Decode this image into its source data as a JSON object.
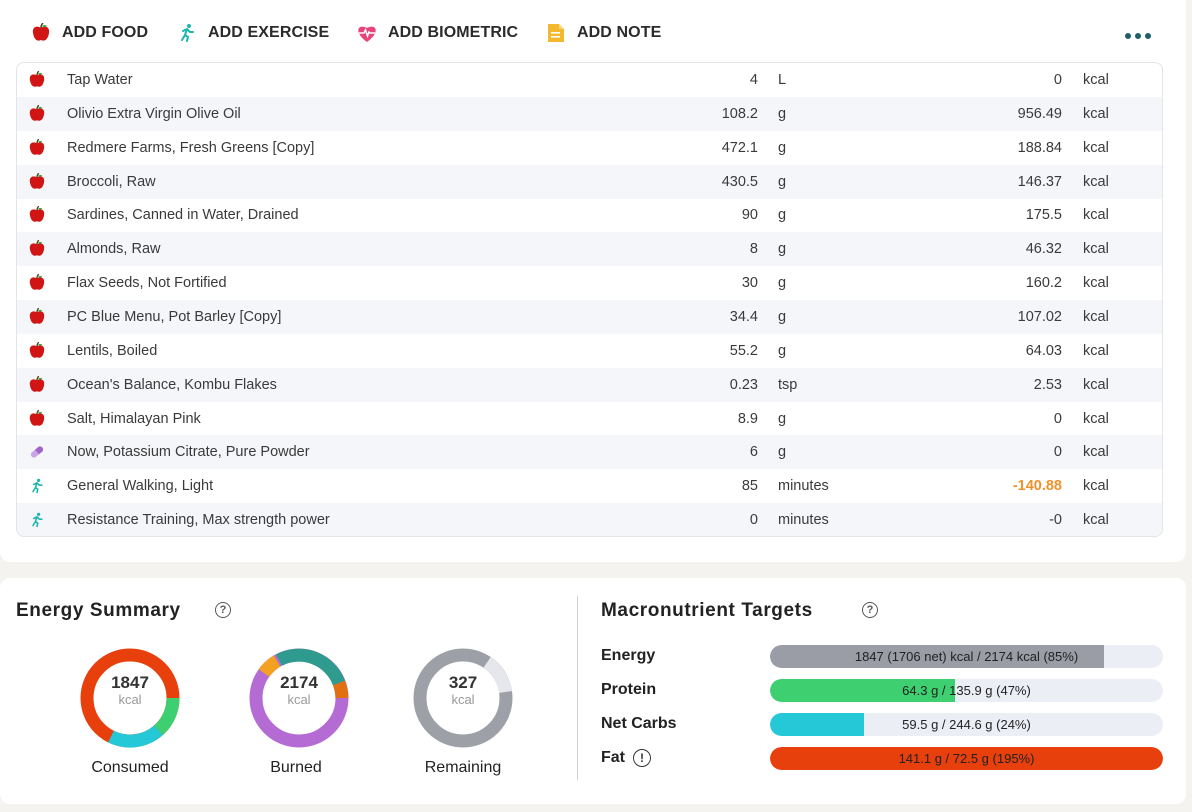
{
  "toolbar": {
    "add_food": "ADD FOOD",
    "add_exercise": "ADD EXERCISE",
    "add_biometric": "ADD BIOMETRIC",
    "add_note": "ADD NOTE"
  },
  "colors": {
    "apple_red": "#d11414",
    "exercise_teal": "#1db6b0",
    "biometric_pink": "#e8457a",
    "note_yellow": "#f2b92e",
    "supplement_purple": "#a165c9",
    "energy_gray": "#9a9ca6",
    "protein_green": "#3ecf70",
    "carbs_cyan": "#24c8d6",
    "fat_red": "#e8400c"
  },
  "diary": {
    "entries": [
      {
        "icon": "apple-icon",
        "name": "Tap Water",
        "amount": "4",
        "unit": "L",
        "calories": "0",
        "cal_unit": "kcal"
      },
      {
        "icon": "apple-icon",
        "name": "Olivio Extra Virgin Olive Oil",
        "amount": "108.2",
        "unit": "g",
        "calories": "956.49",
        "cal_unit": "kcal"
      },
      {
        "icon": "apple-icon",
        "name": "Redmere Farms, Fresh Greens [Copy]",
        "amount": "472.1",
        "unit": "g",
        "calories": "188.84",
        "cal_unit": "kcal"
      },
      {
        "icon": "apple-icon",
        "name": "Broccoli, Raw",
        "amount": "430.5",
        "unit": "g",
        "calories": "146.37",
        "cal_unit": "kcal"
      },
      {
        "icon": "apple-icon",
        "name": "Sardines, Canned in Water, Drained",
        "amount": "90",
        "unit": "g",
        "calories": "175.5",
        "cal_unit": "kcal"
      },
      {
        "icon": "apple-icon",
        "name": "Almonds, Raw",
        "amount": "8",
        "unit": "g",
        "calories": "46.32",
        "cal_unit": "kcal"
      },
      {
        "icon": "apple-icon",
        "name": "Flax Seeds, Not Fortified",
        "amount": "30",
        "unit": "g",
        "calories": "160.2",
        "cal_unit": "kcal"
      },
      {
        "icon": "apple-icon",
        "name": "PC Blue Menu, Pot Barley [Copy]",
        "amount": "34.4",
        "unit": "g",
        "calories": "107.02",
        "cal_unit": "kcal"
      },
      {
        "icon": "apple-icon",
        "name": "Lentils, Boiled",
        "amount": "55.2",
        "unit": "g",
        "calories": "64.03",
        "cal_unit": "kcal"
      },
      {
        "icon": "apple-icon",
        "name": "Ocean's Balance, Kombu Flakes",
        "amount": "0.23",
        "unit": "tsp",
        "calories": "2.53",
        "cal_unit": "kcal"
      },
      {
        "icon": "apple-icon",
        "name": "Salt, Himalayan Pink",
        "amount": "8.9",
        "unit": "g",
        "calories": "0",
        "cal_unit": "kcal"
      },
      {
        "icon": "pill-icon",
        "name": "Now, Potassium Citrate, Pure Powder",
        "amount": "6",
        "unit": "g",
        "calories": "0",
        "cal_unit": "kcal"
      },
      {
        "icon": "running-person-icon",
        "name": "General Walking, Light",
        "amount": "85",
        "unit": "minutes",
        "calories": "-140.88",
        "cal_unit": "kcal"
      },
      {
        "icon": "running-person-icon",
        "name": "Resistance Training, Max strength power",
        "amount": "0",
        "unit": "minutes",
        "calories": "-0",
        "cal_unit": "kcal"
      }
    ]
  },
  "energy_summary": {
    "title": "Energy Summary",
    "help": "?",
    "consumed": {
      "value": "1847",
      "unit": "kcal",
      "label": "Consumed"
    },
    "burned": {
      "value": "2174",
      "unit": "kcal",
      "label": "Burned"
    },
    "remaining": {
      "value": "327",
      "unit": "kcal",
      "label": "Remaining"
    }
  },
  "macro_targets": {
    "title": "Macronutrient Targets",
    "help": "?",
    "rows": [
      {
        "label": "Energy",
        "text": "1847 (1706 net) kcal / 2174 kcal (85%)",
        "fraction": 0.85
      },
      {
        "label": "Protein",
        "text": "64.3 g / 135.9 g (47%)",
        "fraction": 0.47
      },
      {
        "label": "Net Carbs",
        "text": "59.5 g / 244.6 g (24%)",
        "fraction": 0.24
      },
      {
        "label": "Fat",
        "text": "141.1 g / 72.5 g (195%)",
        "fraction": 1.0,
        "warning": "!"
      }
    ]
  }
}
